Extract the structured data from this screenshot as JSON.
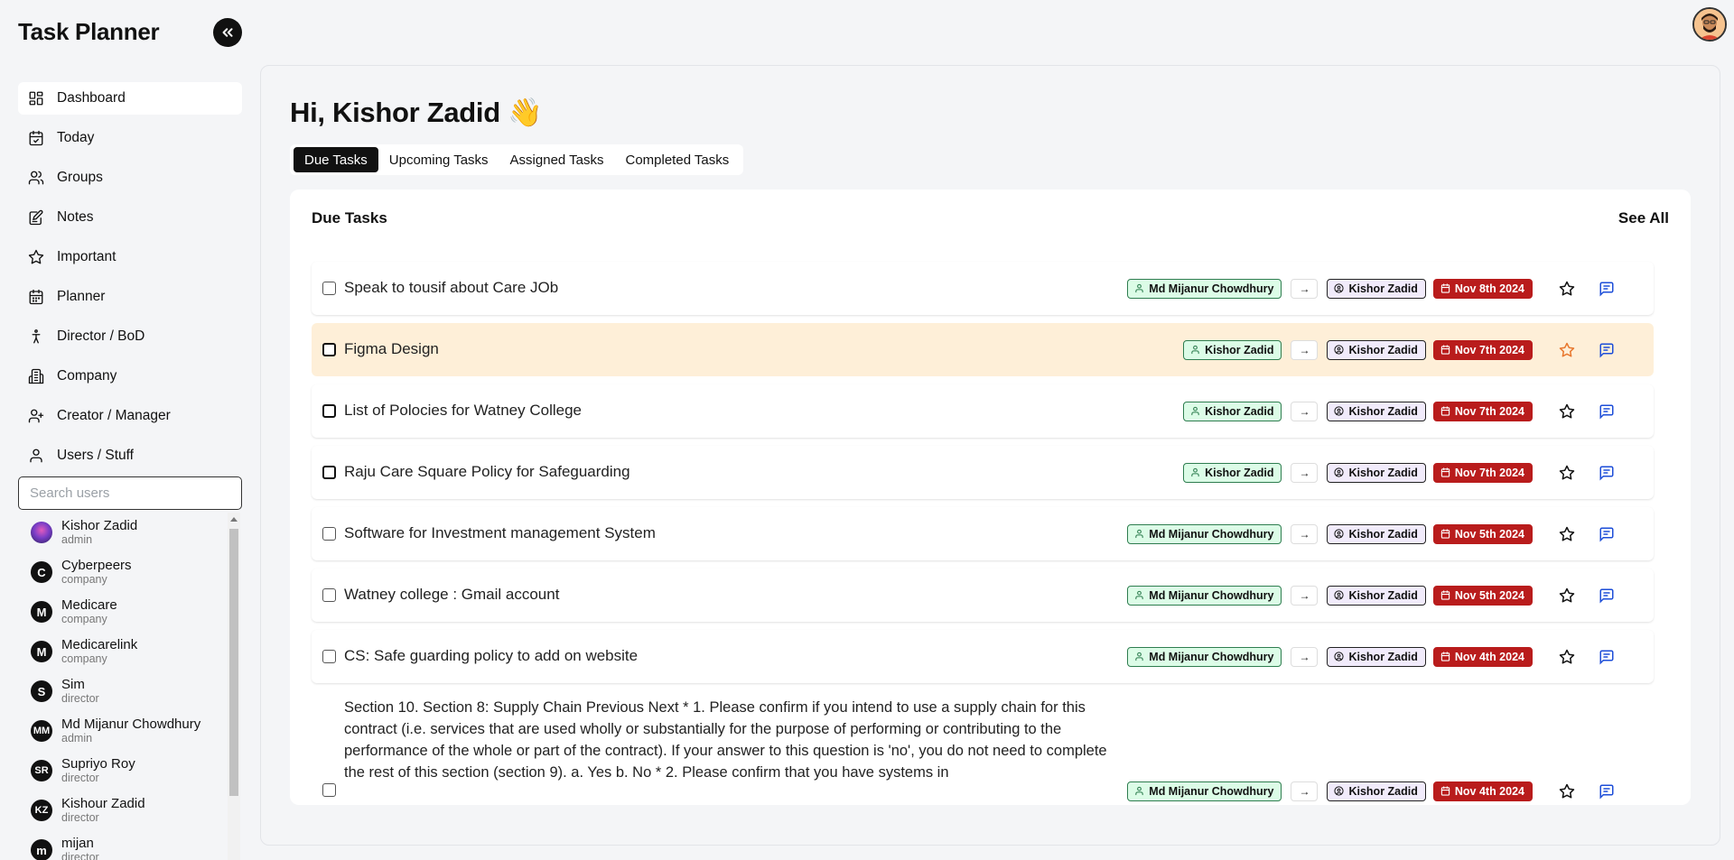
{
  "app": {
    "title": "Task Planner"
  },
  "sidebar": {
    "items": [
      {
        "label": "Dashboard",
        "icon": "dashboard-icon"
      },
      {
        "label": "Today",
        "icon": "calendar-check-icon"
      },
      {
        "label": "Groups",
        "icon": "users-icon"
      },
      {
        "label": "Notes",
        "icon": "notes-icon"
      },
      {
        "label": "Important",
        "icon": "star-icon"
      },
      {
        "label": "Planner",
        "icon": "calendar-icon"
      },
      {
        "label": "Director / BoD",
        "icon": "person-standing-icon"
      },
      {
        "label": "Company",
        "icon": "building-icon"
      },
      {
        "label": "Creator / Manager",
        "icon": "user-plus-icon"
      },
      {
        "label": "Users / Stuff",
        "icon": "user-icon"
      }
    ],
    "search_placeholder": "Search users",
    "users": [
      {
        "name": "Kishor Zadid",
        "role": "admin",
        "initials": ""
      },
      {
        "name": "Cyberpeers",
        "role": "company",
        "initials": "C"
      },
      {
        "name": "Medicare",
        "role": "company",
        "initials": "M"
      },
      {
        "name": "Medicarelink",
        "role": "company",
        "initials": "M"
      },
      {
        "name": "Sim",
        "role": "director",
        "initials": "S"
      },
      {
        "name": "Md Mijanur Chowdhury",
        "role": "admin",
        "initials": "MM"
      },
      {
        "name": "Supriyo Roy",
        "role": "director",
        "initials": "SR"
      },
      {
        "name": "Kishour Zadid",
        "role": "director",
        "initials": "KZ"
      },
      {
        "name": "mijan",
        "role": "director",
        "initials": "m"
      }
    ]
  },
  "main": {
    "greeting": "Hi, Kishor Zadid 👋",
    "tabs": [
      "Due Tasks",
      "Upcoming Tasks",
      "Assigned Tasks",
      "Completed Tasks"
    ],
    "card_title": "Due Tasks",
    "see_all": "See All",
    "tasks": [
      {
        "title": "Speak to tousif about Care JOb",
        "creator": "Md Mijanur Chowdhury",
        "arrow": "→",
        "assignee": "Kishor Zadid",
        "date": "Nov 8th 2024"
      },
      {
        "title": "Figma Design",
        "creator": "Kishor Zadid",
        "arrow": "→",
        "assignee": "Kishor Zadid",
        "date": "Nov 7th 2024"
      },
      {
        "title": "List of Polocies for Watney College",
        "creator": "Kishor Zadid",
        "arrow": "→",
        "assignee": "Kishor Zadid",
        "date": "Nov 7th 2024"
      },
      {
        "title": "Raju Care Square Policy for Safeguarding",
        "creator": "Kishor Zadid",
        "arrow": "→",
        "assignee": "Kishor Zadid",
        "date": "Nov 7th 2024"
      },
      {
        "title": "Software for Investment management System",
        "creator": "Md Mijanur Chowdhury",
        "arrow": "→",
        "assignee": "Kishor Zadid",
        "date": "Nov 5th 2024"
      },
      {
        "title": "Watney college : Gmail account",
        "creator": "Md Mijanur Chowdhury",
        "arrow": "→",
        "assignee": "Kishor Zadid",
        "date": "Nov 5th 2024"
      },
      {
        "title": "CS: Safe guarding policy to add on website",
        "creator": "Md Mijanur Chowdhury",
        "arrow": "→",
        "assignee": "Kishor Zadid",
        "date": "Nov 4th 2024"
      },
      {
        "title": "Section 10. Section 8: Supply Chain Previous Next * 1. Please confirm if you intend to use a supply chain for this contract (i.e. services that are used wholly or substantially for the purpose of performing or contributing to the performance of the whole or part of the contract). If your answer to this question is 'no', you do not need to complete the rest of this section (section 9). a. Yes b. No * 2. Please confirm that you have systems in",
        "creator": "Md Mijanur Chowdhury",
        "arrow": "→",
        "assignee": "Kishor Zadid",
        "date": "Nov 4th 2024"
      }
    ]
  },
  "colors": {
    "accent": "#111111",
    "date_badge": "#b91c1c",
    "creator_badge": "#dcfce7",
    "assignee_badge": "#f1ebfb",
    "highlight_row": "#feefd8",
    "starred": "#e8772e",
    "comment_icon": "#1d4ed8"
  }
}
